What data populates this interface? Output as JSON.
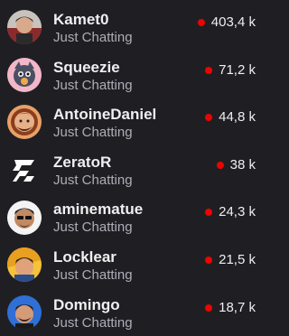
{
  "colors": {
    "background": "#1f1f23",
    "live_dot": "#eb0400",
    "name_text": "#efeff1",
    "category_text": "#adadb8"
  },
  "channels": [
    {
      "name": "Kamet0",
      "category": "Just Chatting",
      "viewers": "403,4 k",
      "avatar_icon": "kamet0-avatar"
    },
    {
      "name": "Squeezie",
      "category": "Just Chatting",
      "viewers": "71,2 k",
      "avatar_icon": "squeezie-avatar"
    },
    {
      "name": "AntoineDaniel",
      "category": "Just Chatting",
      "viewers": "44,8 k",
      "avatar_icon": "antoinedaniel-avatar"
    },
    {
      "name": "ZeratoR",
      "category": "Just Chatting",
      "viewers": "38 k",
      "avatar_icon": "zerator-logo-avatar"
    },
    {
      "name": "aminematue",
      "category": "Just Chatting",
      "viewers": "24,3 k",
      "avatar_icon": "aminematue-avatar"
    },
    {
      "name": "Locklear",
      "category": "Just Chatting",
      "viewers": "21,5 k",
      "avatar_icon": "locklear-avatar"
    },
    {
      "name": "Domingo",
      "category": "Just Chatting",
      "viewers": "18,7 k",
      "avatar_icon": "domingo-avatar"
    }
  ]
}
